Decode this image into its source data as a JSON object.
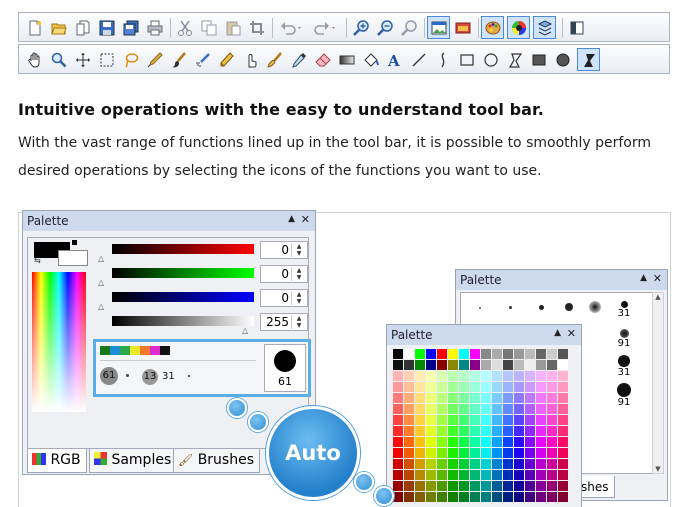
{
  "toolbar_top": {
    "icons": [
      "new-file-icon",
      "open-folder-icon",
      "duplicate-icon",
      "save-icon",
      "save-all-icon",
      "print-icon",
      "cut-icon",
      "copy-icon",
      "paste-icon",
      "crop-icon",
      "undo-icon",
      "redo-icon",
      "zoom-in-icon",
      "zoom-out-icon",
      "zoom-fit-icon",
      "image-view-icon",
      "image-window-icon",
      "palette-icon",
      "color-wheel-icon",
      "layers-icon",
      "panel-toggle-icon"
    ]
  },
  "toolbar_bottom": {
    "icons": [
      "hand-icon",
      "magnifier-icon",
      "move-icon",
      "rect-select-icon",
      "lasso-icon",
      "pen-icon",
      "brush-icon",
      "airbrush-icon",
      "pencil-icon",
      "finger-icon",
      "smudge-icon",
      "eyedropper-icon",
      "eraser-icon",
      "gradient-icon",
      "fill-bucket-icon",
      "text-icon",
      "line-icon",
      "curve-icon",
      "rectangle-icon",
      "ellipse-icon",
      "polygon-icon",
      "filled-rect-icon",
      "filled-ellipse-icon",
      "filled-polygon-icon"
    ]
  },
  "heading": "Intuitive operations with the easy to understand tool bar.",
  "paragraph": "With the vast range of functions lined up in the tool bar, it is possible to smoothly perform desired operations by selecting the icons of the functions you want to use.",
  "palette_main": {
    "title": "Palette",
    "red_value": "0",
    "green_value": "0",
    "blue_value": "0",
    "alpha_value": "255",
    "brush_sizes": [
      "61",
      "13",
      "31"
    ],
    "preview_size": "61",
    "tabs": [
      "RGB",
      "Samples",
      "Brushes"
    ]
  },
  "palette_brushes": {
    "title": "Palette",
    "sizes": [
      "31",
      "91",
      "31",
      "91"
    ],
    "tab_fragment": "shes"
  },
  "palette_samples": {
    "title": "Palette"
  },
  "auto_label": "Auto",
  "colors": {
    "titlebar": "#cddaee",
    "highlight": "#5aaee8",
    "bubble": "#2f8fd6"
  }
}
